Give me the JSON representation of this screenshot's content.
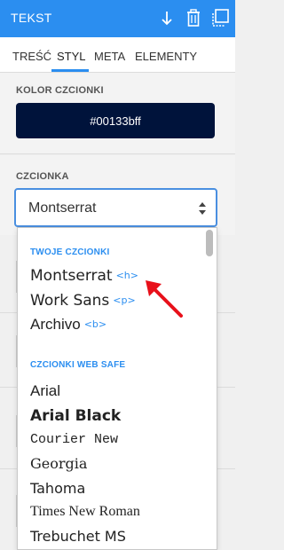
{
  "header": {
    "title": "TEKST"
  },
  "tabs": [
    {
      "label": "TREŚĆ"
    },
    {
      "label": "STYL"
    },
    {
      "label": "META"
    },
    {
      "label": "ELEMENTY"
    }
  ],
  "font_color": {
    "label": "KOLOR CZCIONKI",
    "value": "#00133bff",
    "swatch": "#00133b"
  },
  "font": {
    "label": "CZCIONKA",
    "selected": "Montserrat"
  },
  "dropdown": {
    "user_group_label": "TWOJE CZCIONKI",
    "user_fonts": [
      {
        "name": "Montserrat",
        "tag": "<h>"
      },
      {
        "name": "Work Sans",
        "tag": "<p>"
      },
      {
        "name": "Archivo",
        "tag": "<b>"
      }
    ],
    "websafe_group_label": "CZCIONKI WEB SAFE",
    "websafe_fonts": [
      {
        "name": "Arial"
      },
      {
        "name": "Arial Black"
      },
      {
        "name": "Courier New"
      },
      {
        "name": "Georgia"
      },
      {
        "name": "Tahoma"
      },
      {
        "name": "Times New Roman"
      },
      {
        "name": "Trebuchet MS"
      }
    ]
  },
  "colors": {
    "accent": "#2b8ef0",
    "annotation": "#e8101a"
  }
}
